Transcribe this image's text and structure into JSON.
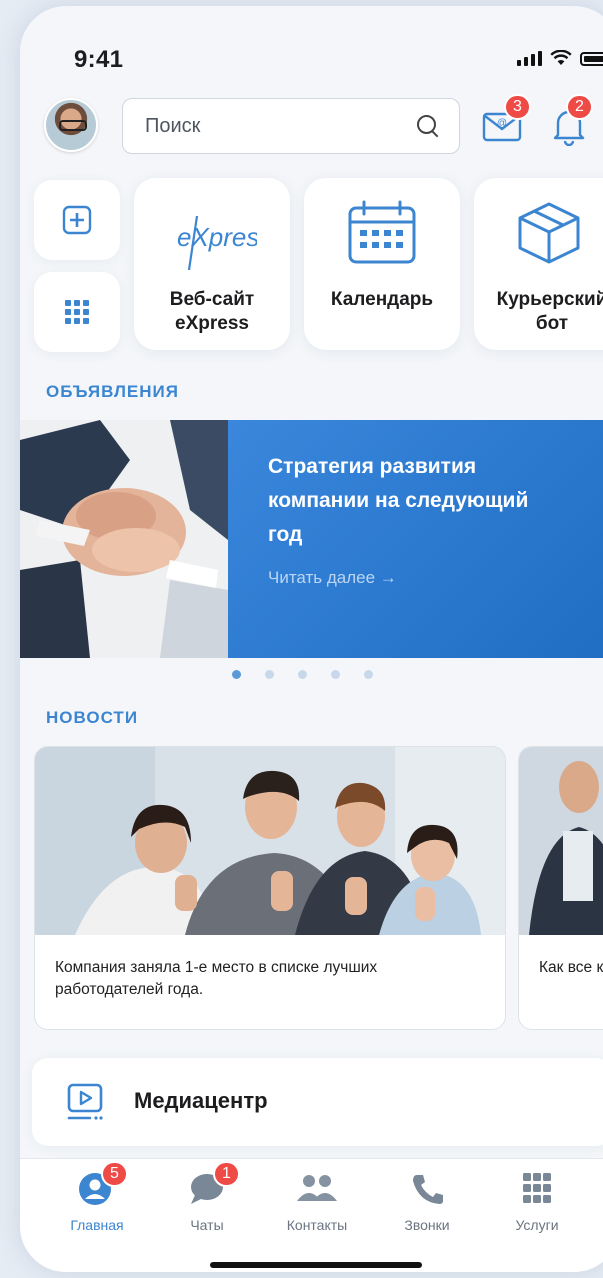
{
  "status_bar": {
    "time": "9:41"
  },
  "header": {
    "search_placeholder": "Поиск",
    "mail_badge": "3",
    "notifications_badge": "2"
  },
  "quick_actions": {
    "tiles": [
      {
        "label": "Веб-сайт\neXpress",
        "icon": "express-logo"
      },
      {
        "label": "Календарь",
        "icon": "calendar-icon"
      },
      {
        "label": "Курьерский\nбот",
        "icon": "box-icon"
      }
    ],
    "express_logo_text": "eXpress"
  },
  "announcements": {
    "title": "ОБЪЯВЛЕНИЯ",
    "banner_title": "Стратегия развития компании на следующий год",
    "read_more": "Читать далее  →",
    "dots_total": 5,
    "dots_active": 0
  },
  "news": {
    "title": "НОВОСТИ",
    "items": [
      {
        "text": "Компания заняла 1-е место в списке лучших работодателей года."
      },
      {
        "text": "Как все корпора"
      }
    ]
  },
  "media": {
    "label": "Медиацентр"
  },
  "tabbar": {
    "tabs": [
      {
        "label": "Главная",
        "badge": "5",
        "active": true
      },
      {
        "label": "Чаты",
        "badge": "1"
      },
      {
        "label": "Контакты"
      },
      {
        "label": "Звонки"
      },
      {
        "label": "Услуги"
      }
    ]
  },
  "colors": {
    "accent": "#3c86d1",
    "badge": "#ee4a46",
    "banner": "#2a7bd2"
  }
}
